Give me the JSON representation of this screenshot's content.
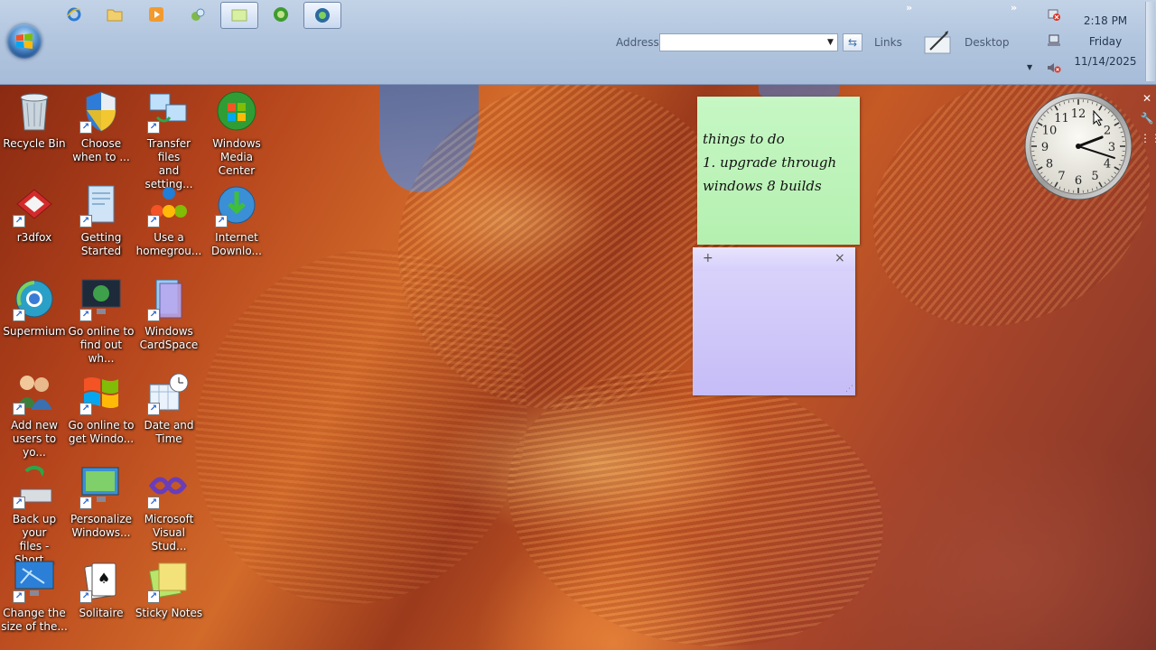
{
  "taskbar": {
    "quick_launch": [
      {
        "name": "internet-explorer-icon",
        "active": false
      },
      {
        "name": "folder-icon",
        "active": false
      },
      {
        "name": "media-player-icon",
        "active": false
      },
      {
        "name": "switch-windows-icon",
        "active": false
      },
      {
        "name": "sticky-notes-task-icon",
        "active": true
      },
      {
        "name": "media-center-task-icon",
        "active": false
      },
      {
        "name": "supermium-task-icon",
        "active": true
      }
    ],
    "address_label": "Address",
    "address_value": "",
    "links_label": "Links",
    "desktop_label": "Desktop",
    "chevron": "»",
    "tray": {
      "time": "2:18 PM",
      "day": "Friday",
      "date": "11/14/2025"
    }
  },
  "desktop_icons": [
    {
      "id": "recycle-bin",
      "label": "Recycle Bin",
      "shortcut": false,
      "kind": "recycle"
    },
    {
      "id": "choose-when",
      "label": "Choose\nwhen to ...",
      "shortcut": true,
      "kind": "shield"
    },
    {
      "id": "transfer-files",
      "label": "Transfer files\nand setting...",
      "shortcut": true,
      "kind": "transfer"
    },
    {
      "id": "windows-media-center",
      "label": "Windows\nMedia Center",
      "shortcut": false,
      "kind": "wmc"
    },
    {
      "id": "r3dfox",
      "label": "r3dfox",
      "shortcut": true,
      "kind": "r3dfox"
    },
    {
      "id": "getting-started",
      "label": "Getting\nStarted",
      "shortcut": true,
      "kind": "doc"
    },
    {
      "id": "use-homegroup",
      "label": "Use a\nhomegrou...",
      "shortcut": true,
      "kind": "homegroup"
    },
    {
      "id": "internet-download",
      "label": "Internet\nDownlo...",
      "shortcut": true,
      "kind": "idm"
    },
    {
      "id": "supermium",
      "label": "Supermium",
      "shortcut": true,
      "kind": "supermium"
    },
    {
      "id": "go-online-find",
      "label": "Go online to\nfind out wh...",
      "shortcut": true,
      "kind": "monitor-win"
    },
    {
      "id": "windows-cardspace",
      "label": "Windows\nCardSpace",
      "shortcut": true,
      "kind": "cardspace"
    },
    {
      "id": "add-users",
      "label": "Add new\nusers to yo...",
      "shortcut": true,
      "kind": "users"
    },
    {
      "id": "go-online-get",
      "label": "Go online to\nget Windo...",
      "shortcut": true,
      "kind": "winflag"
    },
    {
      "id": "date-time",
      "label": "Date and\nTime",
      "shortcut": true,
      "kind": "datetime"
    },
    {
      "id": "backup-files",
      "label": "Back up your\nfiles - Short...",
      "shortcut": true,
      "kind": "backup"
    },
    {
      "id": "personalize",
      "label": "Personalize\nWindows...",
      "shortcut": true,
      "kind": "personalize"
    },
    {
      "id": "visual-studio",
      "label": "Microsoft\nVisual Stud...",
      "shortcut": true,
      "kind": "vs"
    },
    {
      "id": "change-size",
      "label": "Change the\nsize of the...",
      "shortcut": true,
      "kind": "monitor"
    },
    {
      "id": "solitaire",
      "label": "Solitaire",
      "shortcut": true,
      "kind": "cards"
    },
    {
      "id": "sticky-notes",
      "label": "Sticky Notes",
      "shortcut": true,
      "kind": "sticky"
    }
  ],
  "sticky_notes": {
    "green_text": "things to do\n1. upgrade through\nwindows 8 builds",
    "purple_text": "",
    "add_glyph": "+",
    "close_glyph": "×"
  },
  "clock": {
    "time_shown": "2:18",
    "numerals": [
      "12",
      "1",
      "2",
      "3",
      "4",
      "5",
      "6",
      "7",
      "8",
      "9",
      "10",
      "11"
    ]
  },
  "colors": {
    "taskbar": "#b2c6df",
    "note_green": "#b5f0b0",
    "note_purple": "#c6bcf7"
  }
}
